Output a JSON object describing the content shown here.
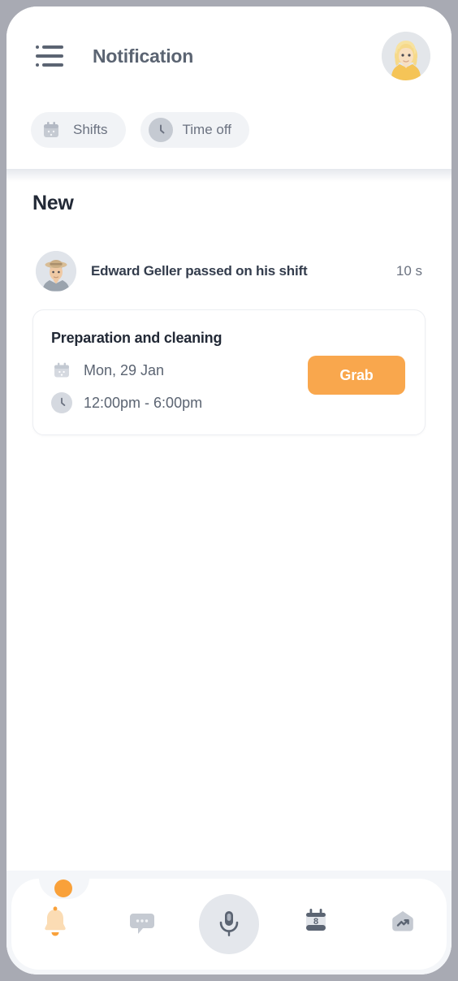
{
  "header": {
    "title": "Notification",
    "menu_icon": "hamburger-menu-icon",
    "avatar_alt": "user-avatar"
  },
  "filters": [
    {
      "label": "Shifts",
      "icon": "calendar-icon",
      "active": false
    },
    {
      "label": "Time off",
      "icon": "clock-icon",
      "active": false
    }
  ],
  "main": {
    "section_title": "New",
    "notification": {
      "text": "Edward Geller passed on his shift",
      "time": "10 s",
      "avatar_alt": "sender-avatar"
    },
    "shift_card": {
      "title": "Preparation and cleaning",
      "date": "Mon, 29 Jan",
      "date_icon": "calendar-icon",
      "time": "12:00pm - 6:00pm",
      "time_icon": "clock-icon",
      "action_label": "Grab"
    }
  },
  "bottom_nav": [
    {
      "icon": "bell-icon",
      "active": true
    },
    {
      "icon": "chat-bubble-icon",
      "active": false
    },
    {
      "icon": "microphone-icon",
      "active": false
    },
    {
      "icon": "calendar-icon",
      "badge": "8",
      "active": false
    },
    {
      "icon": "trending-up-icon",
      "active": false
    }
  ],
  "colors": {
    "accent": "#f9a13a",
    "grab_button": "#f9a74d",
    "text_dark": "#222936",
    "text_muted": "#6b7280",
    "chip_bg": "#f1f3f6",
    "nav_bg": "#f4f6f9"
  }
}
